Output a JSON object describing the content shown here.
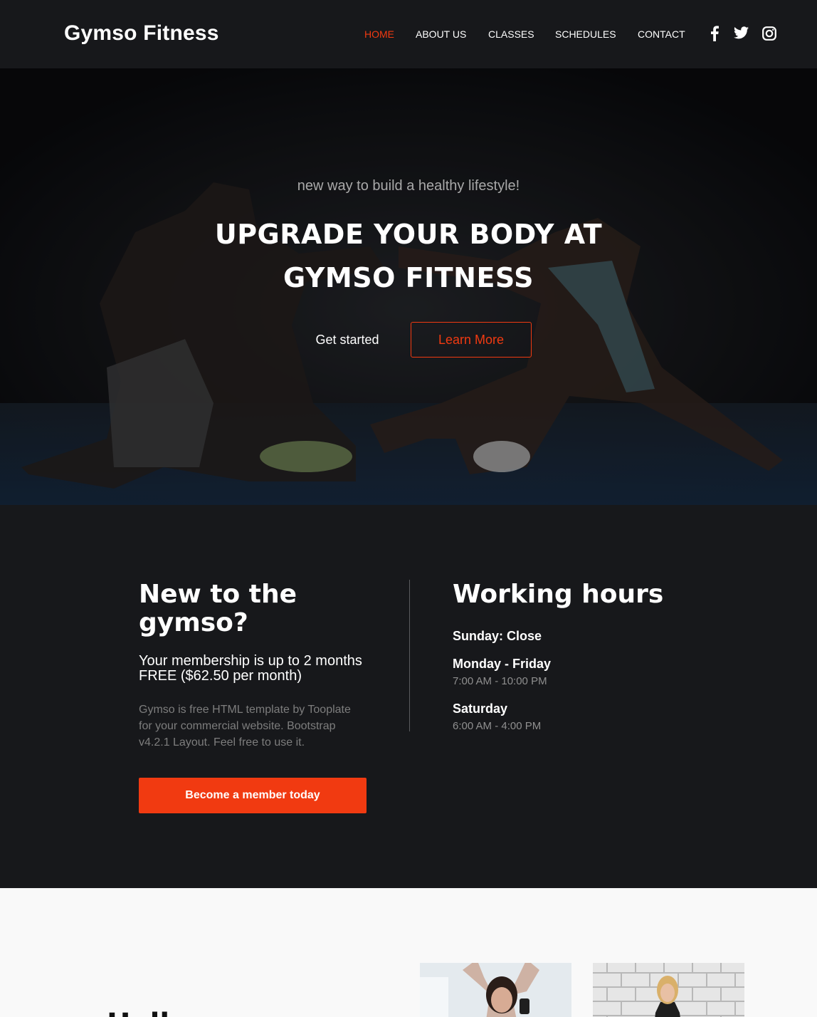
{
  "brand": "Gymso Fitness",
  "nav": {
    "items": [
      {
        "label": "HOME",
        "active": true
      },
      {
        "label": "ABOUT US",
        "active": false
      },
      {
        "label": "CLASSES",
        "active": false
      },
      {
        "label": "SCHEDULES",
        "active": false
      },
      {
        "label": "CONTACT",
        "active": false
      }
    ],
    "social": [
      "facebook-icon",
      "twitter-icon",
      "instagram-icon"
    ]
  },
  "hero": {
    "subtitle": "new way to build a healthy lifestyle!",
    "title_line1": "UPGRADE YOUR BODY AT",
    "title_line2": "GYMSO FITNESS",
    "primary_label": "Get started",
    "secondary_label": "Learn More"
  },
  "membership": {
    "heading_line1": "New to the",
    "heading_line2": "gymso?",
    "lead_line1": "Your membership is up to 2 months",
    "lead_line2": "FREE ($62.50 per month)",
    "desc_line1": "Gymso is free HTML template by Tooplate",
    "desc_line2": "for your commercial website. Bootstrap",
    "desc_line3": "v4.2.1 Layout. Feel free to use it.",
    "cta_label": "Become a member today"
  },
  "hours": {
    "heading": "Working hours",
    "sunday": "Sunday: Close",
    "weekday_label": "Monday - Friday",
    "weekday_time": "7:00 AM - 10:00 PM",
    "saturday_label": "Saturday",
    "saturday_time": "6:00 AM - 4:00 PM"
  },
  "about": {
    "heading_partial": "Hell"
  },
  "colors": {
    "accent": "#f13a11",
    "dark_bg": "#17181b",
    "light_bg": "#f9f9f9"
  }
}
